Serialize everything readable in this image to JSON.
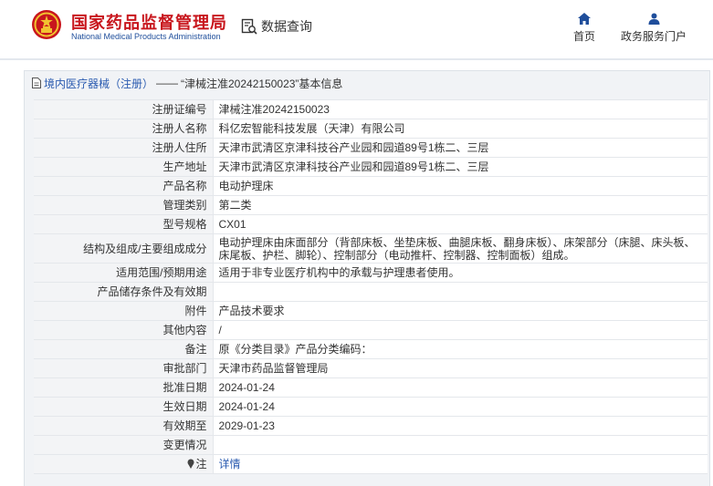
{
  "header": {
    "site_name_cn": "国家药品监督管理局",
    "site_name_en": "National Medical Products Administration",
    "data_query_label": "数据查询",
    "nav": [
      {
        "label": "首页",
        "icon": "home-icon"
      },
      {
        "label": "政务服务门户",
        "icon": "user-icon"
      }
    ]
  },
  "breadcrumb": {
    "section": "境内医疗器械（注册）",
    "separator": "——",
    "title": "“津械注准20242150023”基本信息"
  },
  "info_rows": [
    {
      "label": "注册证编号",
      "value": "津械注准20242150023"
    },
    {
      "label": "注册人名称",
      "value": "科亿宏智能科技发展（天津）有限公司"
    },
    {
      "label": "注册人住所",
      "value": "天津市武清区京津科技谷产业园和园道89号1栋二、三层"
    },
    {
      "label": "生产地址",
      "value": "天津市武清区京津科技谷产业园和园道89号1栋二、三层"
    },
    {
      "label": "产品名称",
      "value": "电动护理床"
    },
    {
      "label": "管理类别",
      "value": "第二类"
    },
    {
      "label": "型号规格",
      "value": "CX01"
    },
    {
      "label": "结构及组成/主要组成成分",
      "value": "电动护理床由床面部分（背部床板、坐垫床板、曲腿床板、翻身床板）、床架部分（床腿、床头板、床尾板、护栏、脚轮）、控制部分（电动推杆、控制器、控制面板）组成。"
    },
    {
      "label": "适用范围/预期用途",
      "value": "适用于非专业医疗机构中的承载与护理患者使用。"
    },
    {
      "label": "产品储存条件及有效期",
      "value": ""
    },
    {
      "label": "附件",
      "value": "产品技术要求"
    },
    {
      "label": "其他内容",
      "value": "/"
    },
    {
      "label": "备注",
      "value": "原《分类目录》产品分类编码："
    },
    {
      "label": "审批部门",
      "value": "天津市药品监督管理局"
    },
    {
      "label": "批准日期",
      "value": "2024-01-24"
    },
    {
      "label": "生效日期",
      "value": "2024-01-24"
    },
    {
      "label": "有效期至",
      "value": "2029-01-23"
    },
    {
      "label": "变更情况",
      "value": ""
    },
    {
      "label": "注",
      "value": "详情",
      "icon": "pin-icon"
    }
  ],
  "colors": {
    "brand_red": "#c8161d",
    "link_blue": "#2a5bb0",
    "nav_icon_blue": "#1f4e9b"
  }
}
